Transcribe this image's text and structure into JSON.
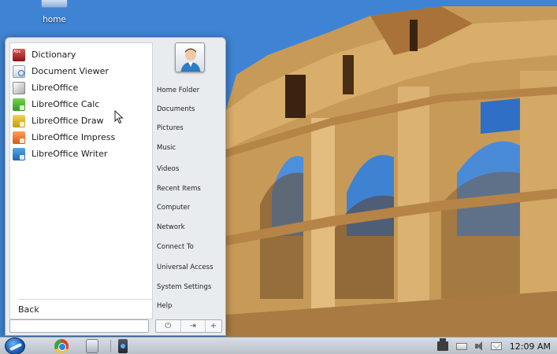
{
  "desktop": {
    "home_icon_label": "home"
  },
  "menu": {
    "apps": [
      {
        "label": "Dictionary",
        "icon": "dictionary-icon"
      },
      {
        "label": "Document Viewer",
        "icon": "document-viewer-icon"
      },
      {
        "label": "LibreOffice",
        "icon": "libreoffice-icon"
      },
      {
        "label": "LibreOffice Calc",
        "icon": "libreoffice-calc-icon"
      },
      {
        "label": "LibreOffice Draw",
        "icon": "libreoffice-draw-icon"
      },
      {
        "label": "LibreOffice Impress",
        "icon": "libreoffice-impress-icon"
      },
      {
        "label": "LibreOffice Writer",
        "icon": "libreoffice-writer-icon"
      }
    ],
    "back_label": "Back",
    "search_placeholder": "",
    "places": [
      "Home Folder",
      "Documents",
      "Pictures",
      "Music",
      "Videos",
      "Recent Items",
      "Computer",
      "Network",
      "Connect To",
      "Universal Access",
      "System Settings",
      "Help"
    ],
    "actions": {
      "power": "⏻",
      "logout": "⇥",
      "add": "+"
    }
  },
  "taskbar": {
    "clock": "12:09 AM",
    "pinned": [
      "chrome-icon",
      "file-manager-icon",
      "app-shortcut-icon"
    ],
    "tray": [
      "network-icon",
      "keyboard-icon",
      "volume-icon",
      "mail-icon"
    ]
  }
}
